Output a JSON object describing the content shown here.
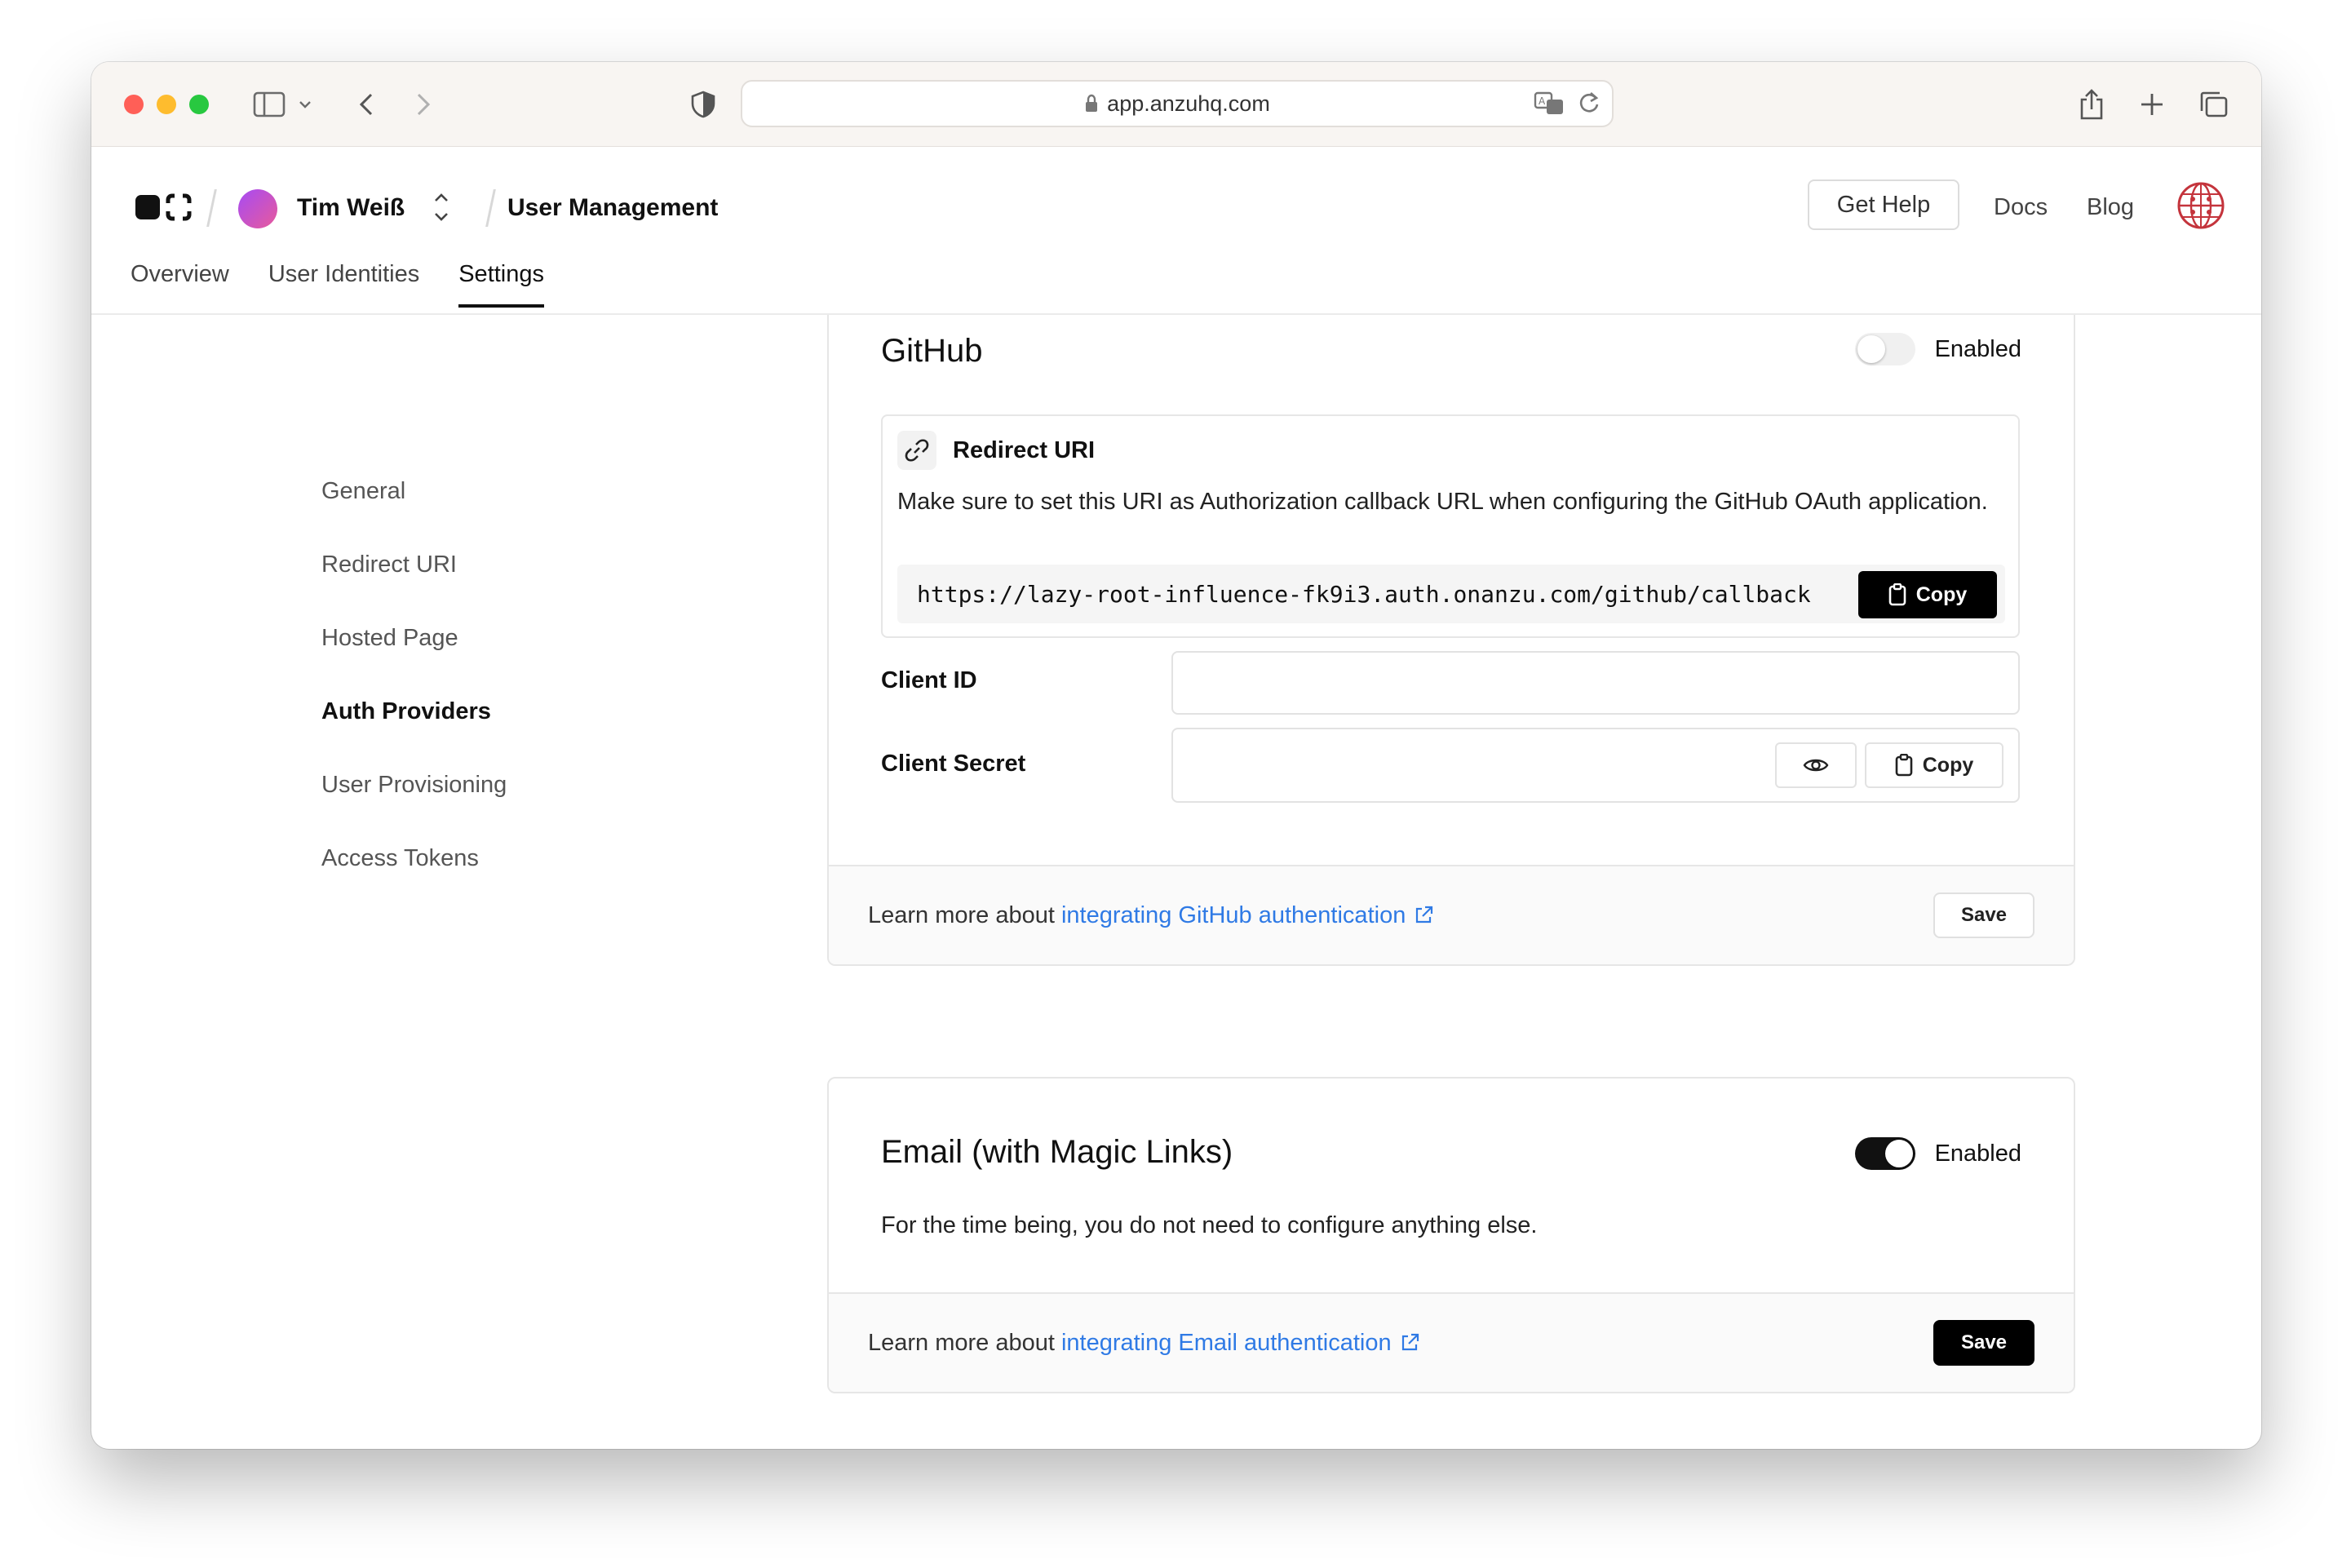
{
  "browser": {
    "url": "app.anzuhq.com"
  },
  "header": {
    "username": "Tim Weiß",
    "section": "User Management",
    "get_help": "Get Help",
    "docs": "Docs",
    "blog": "Blog"
  },
  "tabs": [
    {
      "label": "Overview",
      "active": false
    },
    {
      "label": "User Identities",
      "active": false
    },
    {
      "label": "Settings",
      "active": true
    }
  ],
  "sidenav": [
    {
      "label": "General",
      "active": false
    },
    {
      "label": "Redirect URI",
      "active": false
    },
    {
      "label": "Hosted Page",
      "active": false
    },
    {
      "label": "Auth Providers",
      "active": true
    },
    {
      "label": "User Provisioning",
      "active": false
    },
    {
      "label": "Access Tokens",
      "active": false
    }
  ],
  "github": {
    "title": "GitHub",
    "toggle_label": "Enabled",
    "enabled": false,
    "redirect": {
      "title": "Redirect URI",
      "description": "Make sure to set this URI as Authorization callback URL when configuring the GitHub OAuth application.",
      "uri": "https://lazy-root-influence-fk9i3.auth.onanzu.com/github/callback",
      "copy_label": "Copy"
    },
    "client_id_label": "Client ID",
    "client_id_value": "",
    "client_secret_label": "Client Secret",
    "client_secret_value": "",
    "secret_copy_label": "Copy",
    "footer_prefix": "Learn more about",
    "footer_link": "integrating GitHub authentication",
    "save_label": "Save"
  },
  "email": {
    "title": "Email (with Magic Links)",
    "toggle_label": "Enabled",
    "enabled": true,
    "description": "For the time being, you do not need to configure anything else.",
    "footer_prefix": "Learn more about",
    "footer_link": "integrating Email authentication",
    "save_label": "Save"
  },
  "colors": {
    "link": "#2f7ae5",
    "primary_button": "#000000",
    "avatar_gradient_start": "#a64bf4",
    "avatar_gradient_end": "#e85a9b"
  }
}
